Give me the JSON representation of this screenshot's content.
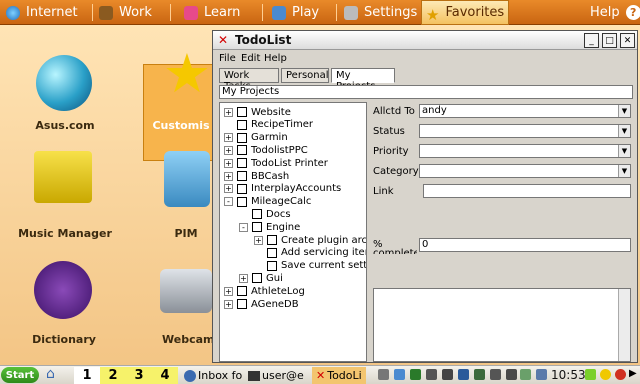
{
  "topbar": {
    "tabs": [
      {
        "label": "Internet",
        "icon": "globe-icon"
      },
      {
        "label": "Work",
        "icon": "briefcase-icon"
      },
      {
        "label": "Learn",
        "icon": "book-icon"
      },
      {
        "label": "Play",
        "icon": "gamepad-icon"
      },
      {
        "label": "Settings",
        "icon": "wrench-icon"
      },
      {
        "label": "Favorites",
        "icon": "star-icon"
      }
    ],
    "help": "Help",
    "active_tab": "Favorites"
  },
  "desktop": {
    "icons": [
      {
        "label": "Asus.com"
      },
      {
        "label": "Customis"
      },
      {
        "label": "Music Manager"
      },
      {
        "label": "PIM"
      },
      {
        "label": "Dictionary"
      },
      {
        "label": "Webcam"
      }
    ]
  },
  "window": {
    "title": "TodoList",
    "menu": [
      "File",
      "Edit",
      "Help"
    ],
    "tabs": [
      "Work Tasks",
      "Personal",
      "My Projects"
    ],
    "active_tab": "My Projects",
    "breadcrumb": "My Projects",
    "tree": [
      {
        "label": "Website",
        "level": 0,
        "expander": "+"
      },
      {
        "label": "RecipeTimer",
        "level": 0,
        "expander": ""
      },
      {
        "label": "Garmin",
        "level": 0,
        "expander": "+"
      },
      {
        "label": "TodolistPPC",
        "level": 0,
        "expander": "+"
      },
      {
        "label": "TodoList Printer",
        "level": 0,
        "expander": "+"
      },
      {
        "label": "BBCash",
        "level": 0,
        "expander": "+"
      },
      {
        "label": "InterplayAccounts",
        "level": 0,
        "expander": "+"
      },
      {
        "label": "MileageCalc",
        "level": 0,
        "expander": "-"
      },
      {
        "label": "Docs",
        "level": 1,
        "expander": ""
      },
      {
        "label": "Engine",
        "level": 1,
        "expander": "-"
      },
      {
        "label": "Create plugin arch",
        "level": 2,
        "expander": "+"
      },
      {
        "label": "Add servicing item",
        "level": 2,
        "expander": ""
      },
      {
        "label": "Save current setti",
        "level": 2,
        "expander": ""
      },
      {
        "label": "Gui",
        "level": 1,
        "expander": "+"
      },
      {
        "label": "AthleteLog",
        "level": 0,
        "expander": "+"
      },
      {
        "label": "AGeneDB",
        "level": 0,
        "expander": "+"
      }
    ],
    "form": {
      "allocated_to_label": "Allctd To",
      "allocated_to_value": "andy",
      "status_label": "Status",
      "status_value": "",
      "priority_label": "Priority",
      "priority_value": "",
      "category_label": "Category",
      "category_value": "",
      "link_label": "Link",
      "link_value": "",
      "percent_label": "% complete",
      "percent_value": "0"
    }
  },
  "taskbar": {
    "start": "Start",
    "workspaces": [
      "1",
      "2",
      "3",
      "4"
    ],
    "tasks": [
      {
        "label": "Inbox fo",
        "icon": "mail-icon"
      },
      {
        "label": "user@e",
        "icon": "terminal-icon"
      },
      {
        "label": "TodoLi",
        "icon": "todolist-icon"
      }
    ],
    "clock": "10:53"
  }
}
